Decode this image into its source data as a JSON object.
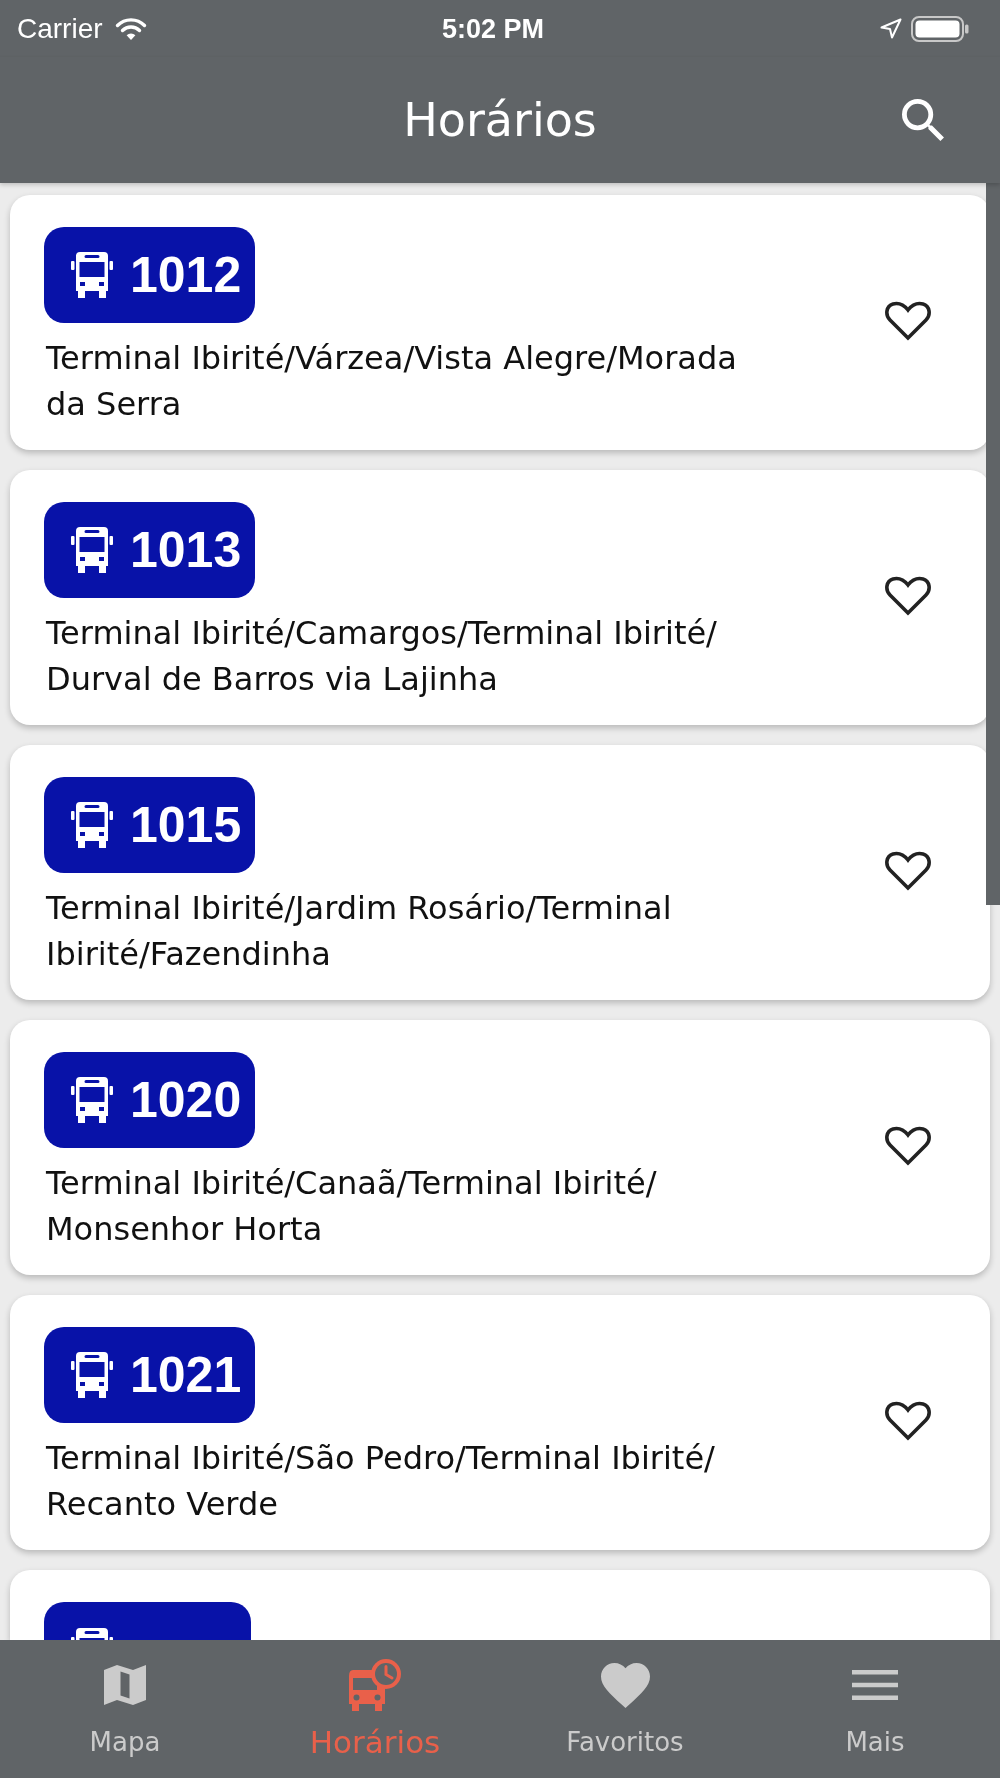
{
  "status_bar": {
    "carrier": "Carrier",
    "time": "5:02 PM"
  },
  "header": {
    "title": "Horários"
  },
  "routes": [
    {
      "kind": "full",
      "number": "1012",
      "description": "Terminal Ibirité/Várzea/Vista Alegre/Morada da Serra",
      "favorite": false
    },
    {
      "kind": "full",
      "number": "1013",
      "description": "Terminal Ibirité/Camargos/Terminal Ibirité/Durval de Barros via Lajinha",
      "favorite": false
    },
    {
      "kind": "full",
      "number": "1015",
      "description": "Terminal Ibirité/Jardim Rosário/Terminal Ibirité/Fazendinha",
      "favorite": false
    },
    {
      "kind": "full",
      "number": "1020",
      "description": "Terminal Ibirité/Canaã/Terminal Ibirité/Monsenhor Horta",
      "favorite": false
    },
    {
      "kind": "full",
      "number": "1021",
      "description": "Terminal Ibirité/São Pedro/Terminal Ibirité/Recanto Verde",
      "favorite": false
    },
    {
      "kind": "cut"
    }
  ],
  "tab_bar": [
    {
      "label": "Mapa",
      "selected": false
    },
    {
      "label": "Horários",
      "selected": true
    },
    {
      "label": "Favoritos",
      "selected": false
    },
    {
      "label": "Mais",
      "selected": false
    }
  ]
}
